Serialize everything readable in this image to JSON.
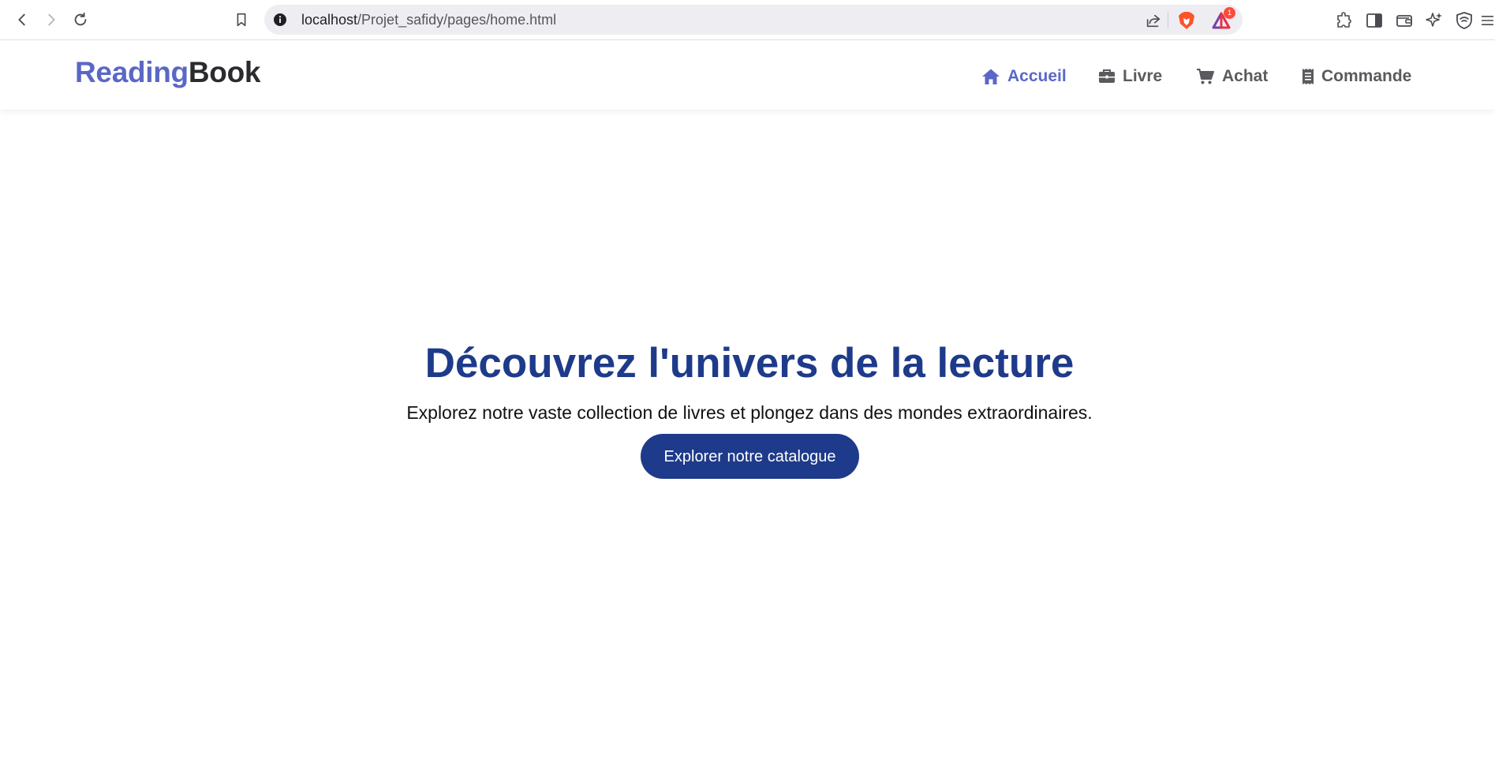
{
  "browser": {
    "url_host": "localhost",
    "url_path": "/Projet_safidy/pages/home.html",
    "extension_badge_count": "1"
  },
  "header": {
    "brand_part1": "Reading",
    "brand_part2": "Book",
    "brand_color": "#5b67c6"
  },
  "nav": {
    "items": [
      {
        "label": "Accueil",
        "icon": "home-icon",
        "active": true
      },
      {
        "label": "Livre",
        "icon": "briefcase-icon",
        "active": false
      },
      {
        "label": "Achat",
        "icon": "cart-icon",
        "active": false
      },
      {
        "label": "Commande",
        "icon": "receipt-icon",
        "active": false
      }
    ]
  },
  "hero": {
    "title": "Découvrez l'univers de la lecture",
    "subtitle": "Explorez notre vaste collection de livres et plongez dans des mondes extraordinaires.",
    "cta_label": "Explorer notre catalogue",
    "accent_color": "#1e3a8a"
  }
}
